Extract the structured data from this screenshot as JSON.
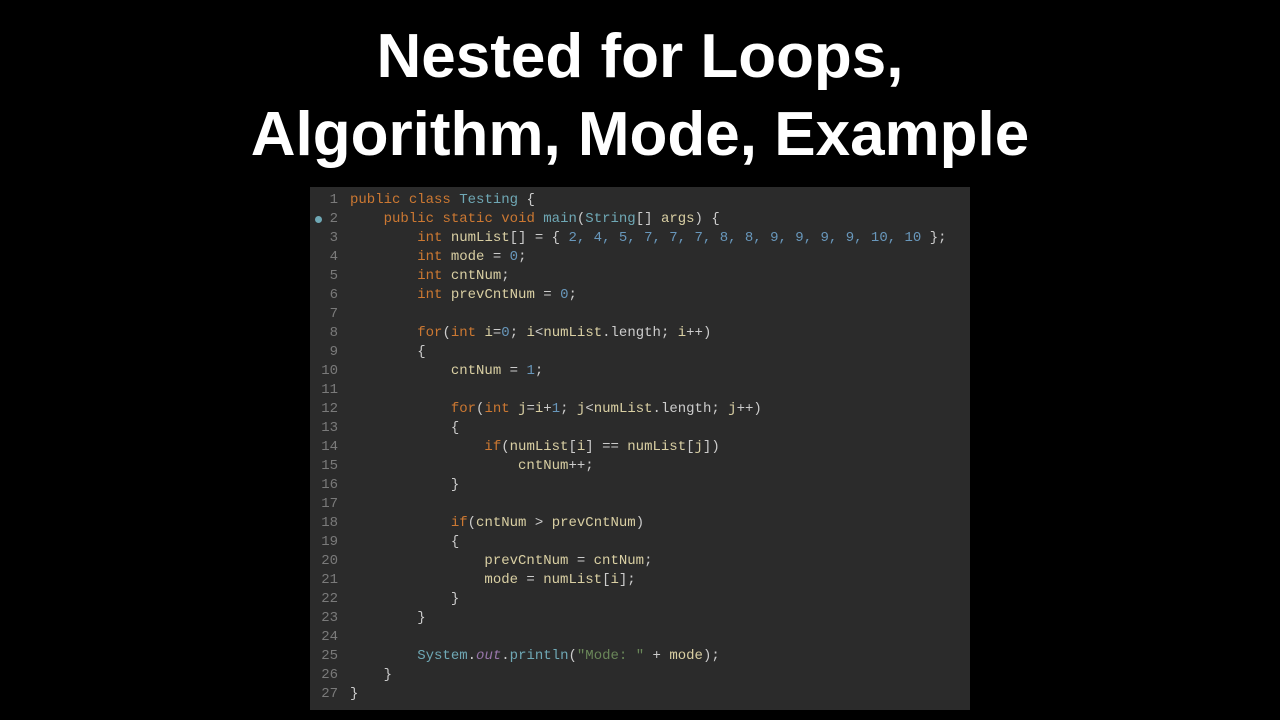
{
  "title": "Nested for Loops,\nAlgorithm, Mode, Example",
  "gutter": {
    "1": "1",
    "2": "2",
    "3": "3",
    "4": "4",
    "5": "5",
    "6": "6",
    "7": "7",
    "8": "8",
    "9": "9",
    "10": "10",
    "11": "11",
    "12": "12",
    "13": "13",
    "14": "14",
    "15": "15",
    "16": "16",
    "17": "17",
    "18": "18",
    "19": "19",
    "20": "20",
    "21": "21",
    "22": "22",
    "23": "23",
    "24": "24",
    "25": "25",
    "26": "26",
    "27": "27"
  },
  "code": {
    "kw_public": "public",
    "kw_class": "class",
    "cls_name": "Testing",
    "brace_open": " {",
    "kw_static": "static",
    "kw_void": "void",
    "fn_main": "main",
    "type_string": "String",
    "args": "args",
    "kw_int": "int",
    "var_numlist": "numList",
    "arr_open": "[] = { ",
    "arr_vals": "2, 4, 5, 7, 7, 7, 8, 8, 9, 9, 9, 9, 10, 10",
    "arr_close": " };",
    "var_mode": "mode",
    "eq0": " = ",
    "zero": "0",
    "semi": ";",
    "var_cntnum": "cntNum",
    "var_prevcntnum": "prevCntNum",
    "kw_for": "for",
    "i": "i",
    "j": "j",
    "langle": "<",
    "length": ".length",
    "one": "1",
    "plus1": "+",
    "inc": "++",
    "kw_if": "if",
    "eqeq": " == ",
    "gt": " > ",
    "sys": "System",
    "out": "out",
    "println": "println",
    "str_mode": "\"Mode: \"",
    "plus": " + ",
    "rbrace": "}",
    "lparen": "(",
    "rparen": ")",
    "lbracket": "[",
    "rbracket": "]",
    "dot": "."
  }
}
